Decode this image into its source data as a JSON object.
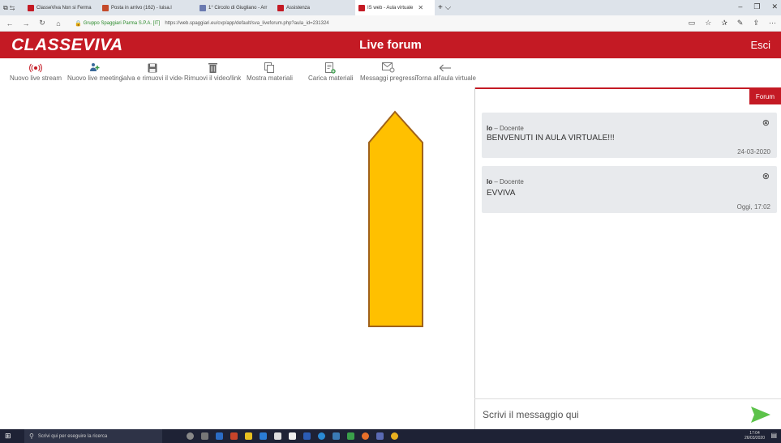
{
  "browser": {
    "tabs": [
      {
        "label": "ClasseViva Non si Ferma",
        "color": "#c41a24"
      },
      {
        "label": "Posta in arrivo (162) - luisa.l",
        "color": "#c44a2a"
      },
      {
        "label": "1° Circolo di Giugliano - Arr",
        "color": "#6a7ab0"
      },
      {
        "label": "Assistenza",
        "color": "#c41a24"
      },
      {
        "label": "IS web - Aula virtuale",
        "color": "#c41a24"
      }
    ],
    "secure_label": "Gruppo Spaggiari Parma S.P.A. [IT]",
    "url": "https://web.spaggiari.eu/cvp/app/default/sva_liveforum.php?aula_id=231324"
  },
  "header": {
    "logo": "CLASSEVIVA",
    "title": "Live forum",
    "exit": "Esci"
  },
  "toolbar": {
    "items": [
      {
        "label": "Nuovo live stream",
        "icon": "broadcast-icon"
      },
      {
        "label": "Nuovo live meeting",
        "icon": "meeting-icon"
      },
      {
        "label": "Salva e rimuovi il video",
        "icon": "save-icon"
      },
      {
        "label": "Rimuovi il video/link",
        "icon": "trash-icon"
      },
      {
        "label": "Mostra materiali",
        "icon": "copy-icon"
      },
      {
        "label": "Carica materiali",
        "icon": "upload-doc-icon"
      },
      {
        "label": "Messaggi pregressi",
        "icon": "mail-icon"
      },
      {
        "label": "Torna all'aula virtuale",
        "icon": "back-arrow-icon"
      }
    ]
  },
  "forum": {
    "tab_label": "Forum",
    "messages": [
      {
        "author": "Io",
        "role": "Docente",
        "text": "BENVENUTI IN AULA VIRTUALE!!!",
        "date": "24-03-2020"
      },
      {
        "author": "Io",
        "role": "Docente",
        "text": "EVVIVA",
        "date": "Oggi, 17:02"
      }
    ],
    "compose_placeholder": "Scrivi il messaggio qui"
  },
  "taskbar": {
    "search_placeholder": "Scrivi qui per eseguire la ricerca",
    "time": "17:04",
    "date": "26/03/2020"
  },
  "colors": {
    "brand": "#c41a24",
    "arrow_fill": "#ffc000",
    "send": "#5cc24a"
  }
}
